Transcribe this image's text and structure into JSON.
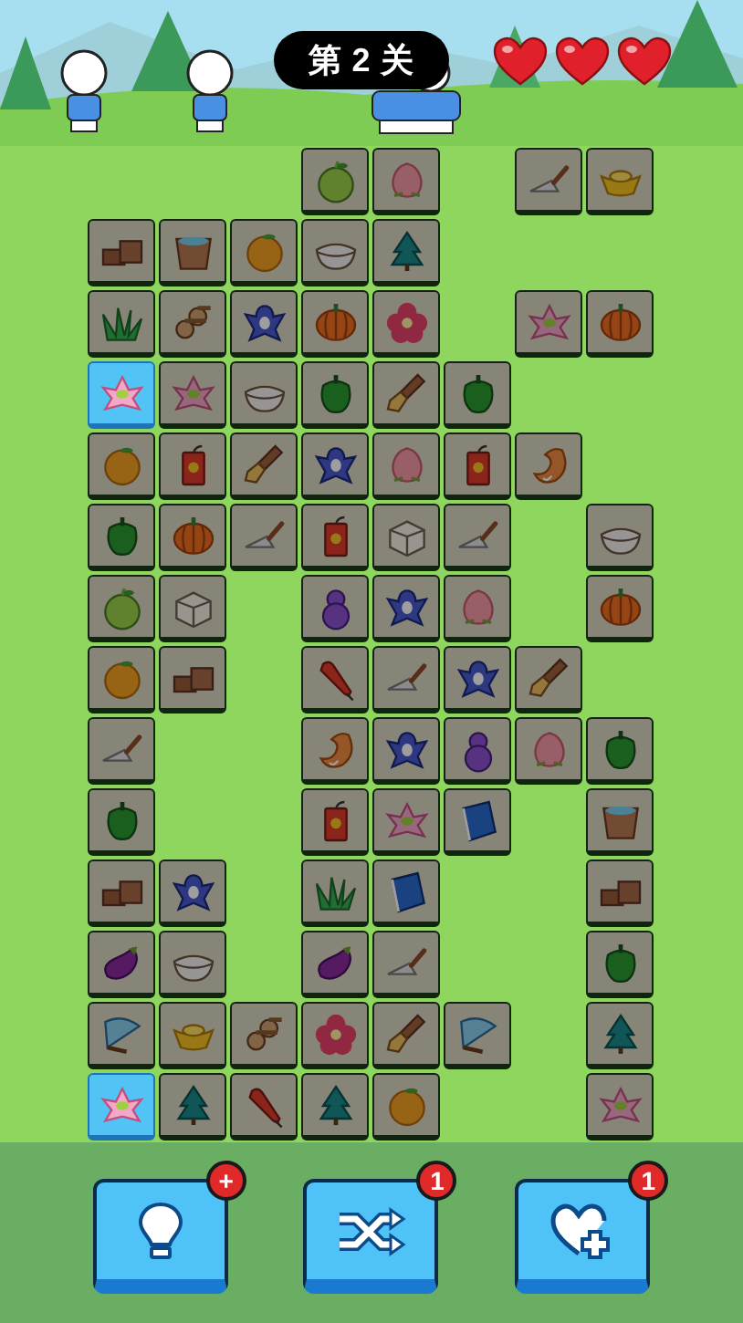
{
  "level_badge": "第 2 关",
  "hearts": [
    {
      "filled": true
    },
    {
      "filled": true
    },
    {
      "filled": true
    }
  ],
  "board": {
    "rows": [
      [
        null,
        null,
        null,
        {
          "kind": "apple",
          "highlighted": false
        },
        {
          "kind": "peach",
          "highlighted": false
        },
        null,
        {
          "kind": "trowel",
          "highlighted": false
        },
        {
          "kind": "gold",
          "highlighted": false
        }
      ],
      [
        {
          "kind": "bricks",
          "highlighted": false
        },
        {
          "kind": "bucket",
          "highlighted": false
        },
        {
          "kind": "orange",
          "highlighted": false
        },
        {
          "kind": "rice",
          "highlighted": false
        },
        {
          "kind": "pine",
          "highlighted": false
        },
        null,
        null,
        null
      ],
      [
        {
          "kind": "grass",
          "highlighted": false
        },
        {
          "kind": "logs",
          "highlighted": false
        },
        {
          "kind": "bird",
          "highlighted": false
        },
        {
          "kind": "pumpkin",
          "highlighted": false
        },
        {
          "kind": "hibiscus",
          "highlighted": false
        },
        null,
        {
          "kind": "lotus",
          "highlighted": false
        },
        {
          "kind": "pumpkin",
          "highlighted": false
        }
      ],
      [
        {
          "kind": "lotus",
          "highlighted": true
        },
        {
          "kind": "lotus",
          "highlighted": false
        },
        {
          "kind": "rice",
          "highlighted": false
        },
        {
          "kind": "pepper",
          "highlighted": false
        },
        {
          "kind": "brush",
          "highlighted": false
        },
        {
          "kind": "pepper",
          "highlighted": false
        },
        null,
        null
      ],
      [
        {
          "kind": "orange",
          "highlighted": false
        },
        {
          "kind": "firecracker",
          "highlighted": false
        },
        {
          "kind": "brush",
          "highlighted": false
        },
        {
          "kind": "bird",
          "highlighted": false
        },
        {
          "kind": "peach",
          "highlighted": false
        },
        {
          "kind": "firecracker",
          "highlighted": false
        },
        {
          "kind": "shrimp",
          "highlighted": false
        },
        null
      ],
      [
        {
          "kind": "pepper",
          "highlighted": false
        },
        {
          "kind": "pumpkin",
          "highlighted": false
        },
        {
          "kind": "trowel",
          "highlighted": false
        },
        {
          "kind": "firecracker",
          "highlighted": false
        },
        {
          "kind": "tofu",
          "highlighted": false
        },
        {
          "kind": "trowel",
          "highlighted": false
        },
        null,
        {
          "kind": "rice",
          "highlighted": false
        }
      ],
      [
        {
          "kind": "apple",
          "highlighted": false
        },
        {
          "kind": "tofu",
          "highlighted": false
        },
        null,
        {
          "kind": "gourd",
          "highlighted": false
        },
        {
          "kind": "bird",
          "highlighted": false
        },
        {
          "kind": "peach",
          "highlighted": false
        },
        null,
        {
          "kind": "pumpkin",
          "highlighted": false
        }
      ],
      [
        {
          "kind": "orange",
          "highlighted": false
        },
        {
          "kind": "bricks",
          "highlighted": false
        },
        null,
        {
          "kind": "rocket",
          "highlighted": false
        },
        {
          "kind": "trowel",
          "highlighted": false
        },
        {
          "kind": "bird",
          "highlighted": false
        },
        {
          "kind": "brush",
          "highlighted": false
        },
        null
      ],
      [
        {
          "kind": "trowel",
          "highlighted": false
        },
        null,
        null,
        {
          "kind": "shrimp",
          "highlighted": false
        },
        {
          "kind": "bird",
          "highlighted": false
        },
        {
          "kind": "gourd",
          "highlighted": false
        },
        {
          "kind": "peach",
          "highlighted": false
        },
        {
          "kind": "pepper",
          "highlighted": false
        }
      ],
      [
        {
          "kind": "pepper",
          "highlighted": false
        },
        null,
        null,
        {
          "kind": "firecracker",
          "highlighted": false
        },
        {
          "kind": "lotus",
          "highlighted": false
        },
        {
          "kind": "book",
          "highlighted": false
        },
        null,
        {
          "kind": "bucket",
          "highlighted": false
        }
      ],
      [
        {
          "kind": "bricks",
          "highlighted": false
        },
        {
          "kind": "bird",
          "highlighted": false
        },
        null,
        {
          "kind": "grass",
          "highlighted": false
        },
        {
          "kind": "book",
          "highlighted": false
        },
        null,
        null,
        {
          "kind": "bricks",
          "highlighted": false
        }
      ],
      [
        {
          "kind": "eggplant",
          "highlighted": false
        },
        {
          "kind": "rice",
          "highlighted": false
        },
        null,
        {
          "kind": "eggplant",
          "highlighted": false
        },
        {
          "kind": "trowel",
          "highlighted": false
        },
        null,
        null,
        {
          "kind": "pepper",
          "highlighted": false
        }
      ],
      [
        {
          "kind": "fan",
          "highlighted": false
        },
        {
          "kind": "gold",
          "highlighted": false
        },
        {
          "kind": "logs",
          "highlighted": false
        },
        {
          "kind": "hibiscus",
          "highlighted": false
        },
        {
          "kind": "brush",
          "highlighted": false
        },
        {
          "kind": "fan",
          "highlighted": false
        },
        null,
        {
          "kind": "pine",
          "highlighted": false
        }
      ],
      [
        {
          "kind": "lotus",
          "highlighted": true
        },
        {
          "kind": "pine",
          "highlighted": false
        },
        {
          "kind": "rocket",
          "highlighted": false
        },
        {
          "kind": "pine",
          "highlighted": false
        },
        {
          "kind": "orange",
          "highlighted": false
        },
        null,
        null,
        {
          "kind": "lotus",
          "highlighted": false
        }
      ]
    ]
  },
  "tools": [
    {
      "kind": "hint",
      "badge": "+"
    },
    {
      "kind": "shuffle",
      "badge": "1"
    },
    {
      "kind": "add_life",
      "badge": "1"
    }
  ]
}
